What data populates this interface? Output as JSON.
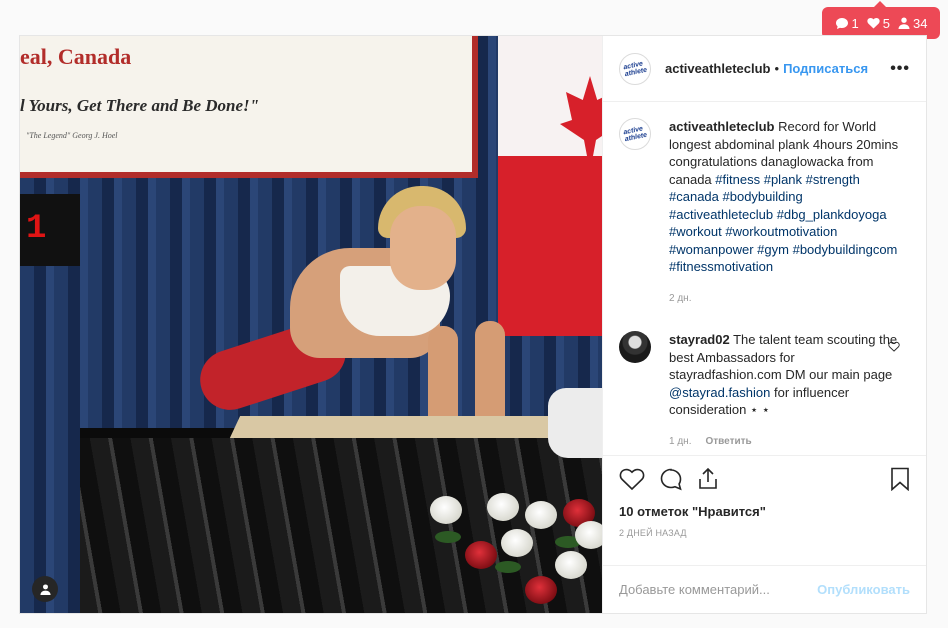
{
  "notifications": {
    "comments": "1",
    "likes": "5",
    "followers": "34",
    "color": "#ed4956"
  },
  "photo": {
    "banner_line1": "eal, Canada",
    "banner_line2": "l Yours, Get There and Be Done!\"",
    "banner_line3": "\"The Legend\" Georg J. Hoel",
    "timer": "1"
  },
  "header": {
    "username": "activeathleteclub",
    "separator": "•",
    "follow_label": "Подписаться",
    "more_label": "•••"
  },
  "caption": {
    "username": "activeathleteclub",
    "text": "Record for World longest abdominal plank 4hours 20mins congratulations danaglowacka from canada",
    "hashtags": [
      "#fitness",
      "#plank",
      "#strength",
      "#canada",
      "#bodybuilding",
      "#activeathleteclub",
      "#dbg_plankdoyoga",
      "#workout",
      "#workoutmotivation",
      "#womanpower",
      "#gym",
      "#bodybuildingcom",
      "#fitnessmotivation"
    ],
    "time": "2 дн."
  },
  "comment": {
    "username": "stayrad02",
    "text_before": "The talent team scouting the best Ambassadors for stayradfashion.com DM our main page",
    "mention": "@stayrad.fashion",
    "text_after": "for influencer consideration ⋆ ⋆",
    "time": "1 дн.",
    "reply_label": "Ответить"
  },
  "actions": {
    "likes_text": "10 отметок \"Нравится\"",
    "date_text": "2 ДНЕЙ НАЗАД"
  },
  "add_comment": {
    "placeholder": "Добавьте комментарий...",
    "publish_label": "Опубликовать"
  },
  "colors": {
    "link": "#003569",
    "follow": "#3897f0",
    "publish_disabled": "#b2dffc"
  }
}
